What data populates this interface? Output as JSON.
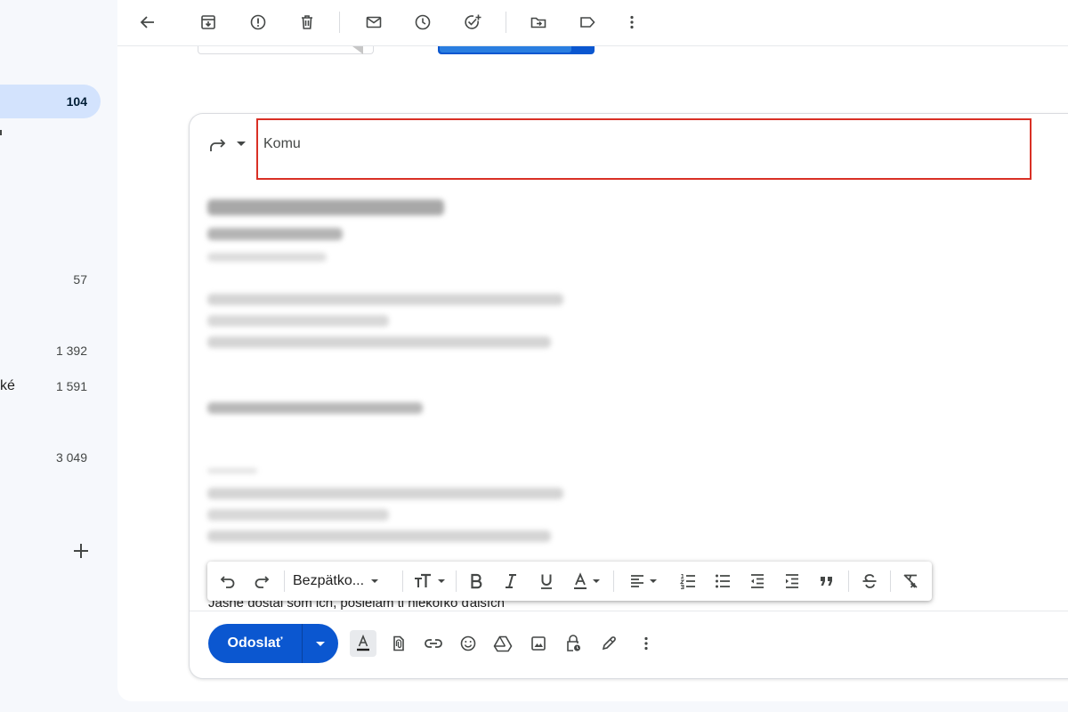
{
  "sidebar": {
    "counts": [
      {
        "value": "104",
        "active": true
      },
      {
        "value": "57"
      },
      {
        "value": "1 392"
      },
      {
        "value": "1 591"
      },
      {
        "value": "3 049"
      }
    ],
    "fragment": "ké"
  },
  "toolbar": {
    "icons": [
      "back-arrow-icon",
      "archive-icon",
      "report-spam-icon",
      "delete-icon",
      "mark-unread-icon",
      "snooze-icon",
      "add-to-tasks-icon",
      "move-to-icon",
      "label-icon",
      "more-vert-icon"
    ]
  },
  "compose": {
    "to_label": "Komu",
    "snippet": "Jasné dostal som ich, posielam ti niekoľko ďalších",
    "format_toolbar": {
      "font_name": "Bezpätko..."
    },
    "send": {
      "label": "Odoslať"
    }
  },
  "colors": {
    "primary": "#0b57d0",
    "active_nav": "#d3e3fd",
    "highlight_border": "#d93025"
  }
}
